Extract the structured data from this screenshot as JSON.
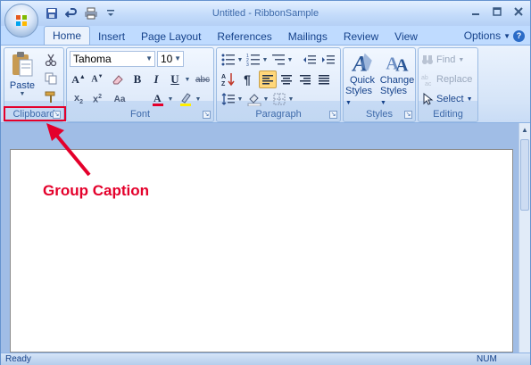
{
  "window": {
    "title": "Untitled - RibbonSample",
    "controls": [
      "minimize",
      "maximize",
      "close"
    ]
  },
  "quick_access": [
    "save-icon",
    "undo-icon",
    "print-icon",
    "customize-icon"
  ],
  "tabs": [
    {
      "label": "Home",
      "active": true
    },
    {
      "label": "Insert"
    },
    {
      "label": "Page Layout"
    },
    {
      "label": "References"
    },
    {
      "label": "Mailings"
    },
    {
      "label": "Review"
    },
    {
      "label": "View"
    }
  ],
  "options_label": "Options",
  "groups": {
    "clipboard": {
      "caption": "Clipboard",
      "paste_label": "Paste"
    },
    "font": {
      "caption": "Font",
      "font_name": "Tahoma",
      "font_size": "10"
    },
    "paragraph": {
      "caption": "Paragraph"
    },
    "styles": {
      "caption": "Styles",
      "quick_styles_line1": "Quick",
      "quick_styles_line2": "Styles",
      "change_styles_line1": "Change",
      "change_styles_line2": "Styles"
    },
    "editing": {
      "caption": "Editing",
      "find_label": "Find",
      "replace_label": "Replace",
      "select_label": "Select"
    }
  },
  "status": {
    "ready": "Ready",
    "num": "NUM"
  },
  "annotation": {
    "text": "Group Caption",
    "color": "#e4002b"
  }
}
